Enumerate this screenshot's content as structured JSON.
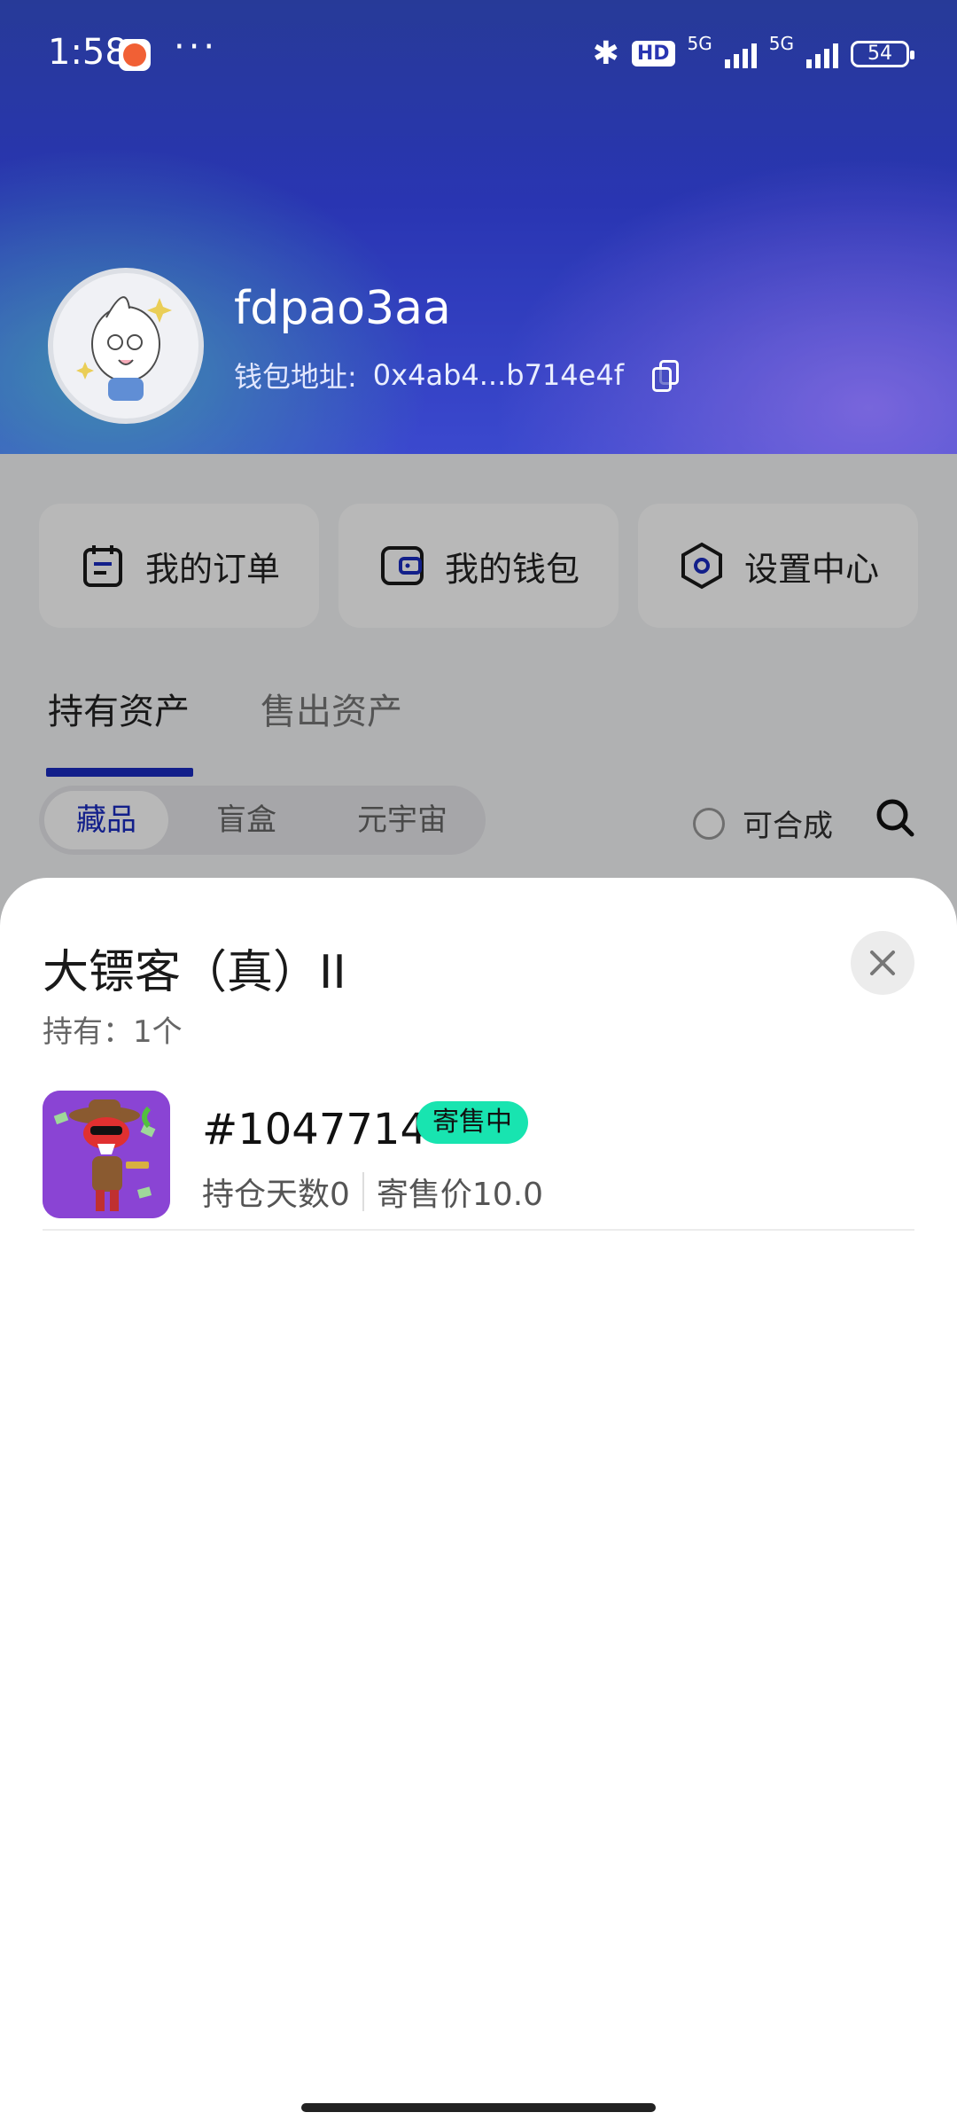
{
  "status_bar": {
    "time": "1:58",
    "more": "···",
    "hd": "HD",
    "net1": "5G",
    "net2": "5G",
    "battery": "54"
  },
  "profile": {
    "username": "fdpao3aa",
    "wallet_label": "钱包地址:",
    "wallet_address": "0x4ab4...b714e4f"
  },
  "menu": [
    {
      "label": "我的订单",
      "icon": "order-icon"
    },
    {
      "label": "我的钱包",
      "icon": "wallet-icon"
    },
    {
      "label": "设置中心",
      "icon": "settings-icon"
    }
  ],
  "tabs": {
    "held": "持有资产",
    "sold": "售出资产",
    "active": "held"
  },
  "segments": {
    "items": [
      "藏品",
      "盲盒",
      "元宇宙"
    ],
    "active": "藏品"
  },
  "filter": {
    "composable_label": "可合成"
  },
  "sheet": {
    "title": "大镖客（真）II",
    "held": "持有：1个",
    "items": [
      {
        "id": "#1047714",
        "badge": "寄售中",
        "days": "持仓天数0",
        "price": "寄售价10.0"
      }
    ]
  },
  "colors": {
    "accent": "#1a2cc0",
    "badge": "#18e4b0",
    "header_top": "#0a1f8a"
  }
}
